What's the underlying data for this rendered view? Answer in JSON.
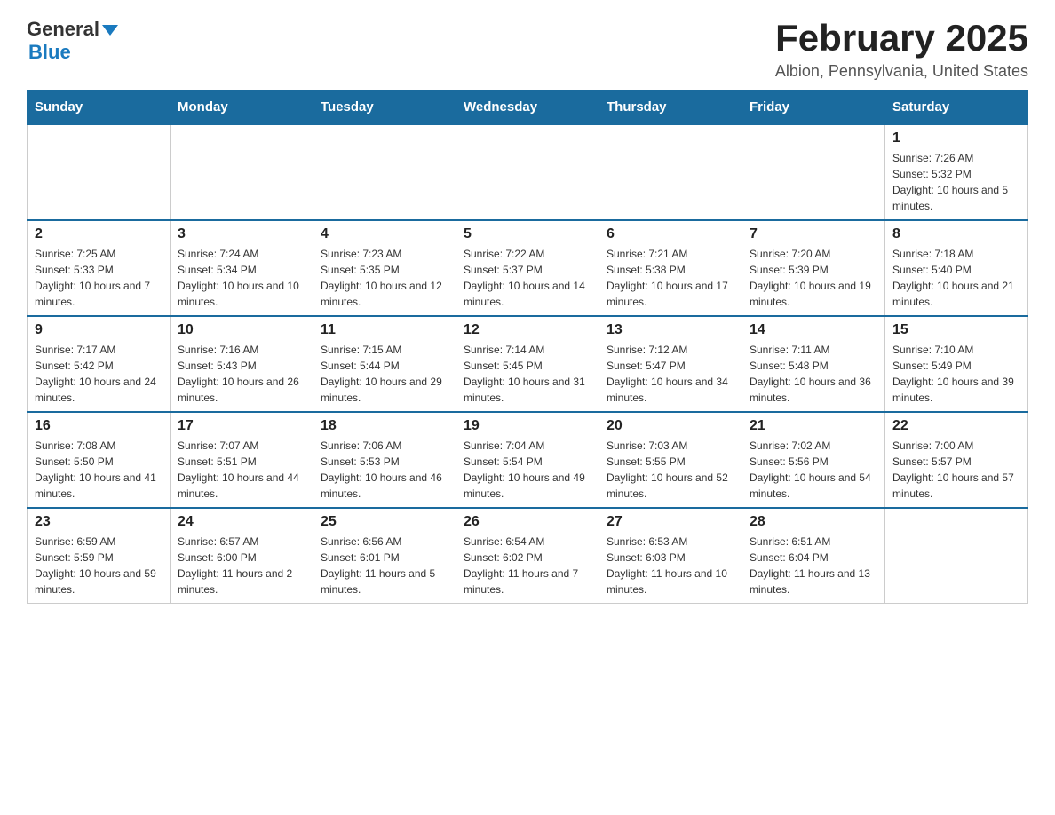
{
  "header": {
    "logo_general": "General",
    "logo_blue": "Blue",
    "month_title": "February 2025",
    "location": "Albion, Pennsylvania, United States"
  },
  "weekdays": [
    "Sunday",
    "Monday",
    "Tuesday",
    "Wednesday",
    "Thursday",
    "Friday",
    "Saturday"
  ],
  "weeks": [
    [
      {
        "day": "",
        "sunrise": "",
        "sunset": "",
        "daylight": ""
      },
      {
        "day": "",
        "sunrise": "",
        "sunset": "",
        "daylight": ""
      },
      {
        "day": "",
        "sunrise": "",
        "sunset": "",
        "daylight": ""
      },
      {
        "day": "",
        "sunrise": "",
        "sunset": "",
        "daylight": ""
      },
      {
        "day": "",
        "sunrise": "",
        "sunset": "",
        "daylight": ""
      },
      {
        "day": "",
        "sunrise": "",
        "sunset": "",
        "daylight": ""
      },
      {
        "day": "1",
        "sunrise": "Sunrise: 7:26 AM",
        "sunset": "Sunset: 5:32 PM",
        "daylight": "Daylight: 10 hours and 5 minutes."
      }
    ],
    [
      {
        "day": "2",
        "sunrise": "Sunrise: 7:25 AM",
        "sunset": "Sunset: 5:33 PM",
        "daylight": "Daylight: 10 hours and 7 minutes."
      },
      {
        "day": "3",
        "sunrise": "Sunrise: 7:24 AM",
        "sunset": "Sunset: 5:34 PM",
        "daylight": "Daylight: 10 hours and 10 minutes."
      },
      {
        "day": "4",
        "sunrise": "Sunrise: 7:23 AM",
        "sunset": "Sunset: 5:35 PM",
        "daylight": "Daylight: 10 hours and 12 minutes."
      },
      {
        "day": "5",
        "sunrise": "Sunrise: 7:22 AM",
        "sunset": "Sunset: 5:37 PM",
        "daylight": "Daylight: 10 hours and 14 minutes."
      },
      {
        "day": "6",
        "sunrise": "Sunrise: 7:21 AM",
        "sunset": "Sunset: 5:38 PM",
        "daylight": "Daylight: 10 hours and 17 minutes."
      },
      {
        "day": "7",
        "sunrise": "Sunrise: 7:20 AM",
        "sunset": "Sunset: 5:39 PM",
        "daylight": "Daylight: 10 hours and 19 minutes."
      },
      {
        "day": "8",
        "sunrise": "Sunrise: 7:18 AM",
        "sunset": "Sunset: 5:40 PM",
        "daylight": "Daylight: 10 hours and 21 minutes."
      }
    ],
    [
      {
        "day": "9",
        "sunrise": "Sunrise: 7:17 AM",
        "sunset": "Sunset: 5:42 PM",
        "daylight": "Daylight: 10 hours and 24 minutes."
      },
      {
        "day": "10",
        "sunrise": "Sunrise: 7:16 AM",
        "sunset": "Sunset: 5:43 PM",
        "daylight": "Daylight: 10 hours and 26 minutes."
      },
      {
        "day": "11",
        "sunrise": "Sunrise: 7:15 AM",
        "sunset": "Sunset: 5:44 PM",
        "daylight": "Daylight: 10 hours and 29 minutes."
      },
      {
        "day": "12",
        "sunrise": "Sunrise: 7:14 AM",
        "sunset": "Sunset: 5:45 PM",
        "daylight": "Daylight: 10 hours and 31 minutes."
      },
      {
        "day": "13",
        "sunrise": "Sunrise: 7:12 AM",
        "sunset": "Sunset: 5:47 PM",
        "daylight": "Daylight: 10 hours and 34 minutes."
      },
      {
        "day": "14",
        "sunrise": "Sunrise: 7:11 AM",
        "sunset": "Sunset: 5:48 PM",
        "daylight": "Daylight: 10 hours and 36 minutes."
      },
      {
        "day": "15",
        "sunrise": "Sunrise: 7:10 AM",
        "sunset": "Sunset: 5:49 PM",
        "daylight": "Daylight: 10 hours and 39 minutes."
      }
    ],
    [
      {
        "day": "16",
        "sunrise": "Sunrise: 7:08 AM",
        "sunset": "Sunset: 5:50 PM",
        "daylight": "Daylight: 10 hours and 41 minutes."
      },
      {
        "day": "17",
        "sunrise": "Sunrise: 7:07 AM",
        "sunset": "Sunset: 5:51 PM",
        "daylight": "Daylight: 10 hours and 44 minutes."
      },
      {
        "day": "18",
        "sunrise": "Sunrise: 7:06 AM",
        "sunset": "Sunset: 5:53 PM",
        "daylight": "Daylight: 10 hours and 46 minutes."
      },
      {
        "day": "19",
        "sunrise": "Sunrise: 7:04 AM",
        "sunset": "Sunset: 5:54 PM",
        "daylight": "Daylight: 10 hours and 49 minutes."
      },
      {
        "day": "20",
        "sunrise": "Sunrise: 7:03 AM",
        "sunset": "Sunset: 5:55 PM",
        "daylight": "Daylight: 10 hours and 52 minutes."
      },
      {
        "day": "21",
        "sunrise": "Sunrise: 7:02 AM",
        "sunset": "Sunset: 5:56 PM",
        "daylight": "Daylight: 10 hours and 54 minutes."
      },
      {
        "day": "22",
        "sunrise": "Sunrise: 7:00 AM",
        "sunset": "Sunset: 5:57 PM",
        "daylight": "Daylight: 10 hours and 57 minutes."
      }
    ],
    [
      {
        "day": "23",
        "sunrise": "Sunrise: 6:59 AM",
        "sunset": "Sunset: 5:59 PM",
        "daylight": "Daylight: 10 hours and 59 minutes."
      },
      {
        "day": "24",
        "sunrise": "Sunrise: 6:57 AM",
        "sunset": "Sunset: 6:00 PM",
        "daylight": "Daylight: 11 hours and 2 minutes."
      },
      {
        "day": "25",
        "sunrise": "Sunrise: 6:56 AM",
        "sunset": "Sunset: 6:01 PM",
        "daylight": "Daylight: 11 hours and 5 minutes."
      },
      {
        "day": "26",
        "sunrise": "Sunrise: 6:54 AM",
        "sunset": "Sunset: 6:02 PM",
        "daylight": "Daylight: 11 hours and 7 minutes."
      },
      {
        "day": "27",
        "sunrise": "Sunrise: 6:53 AM",
        "sunset": "Sunset: 6:03 PM",
        "daylight": "Daylight: 11 hours and 10 minutes."
      },
      {
        "day": "28",
        "sunrise": "Sunrise: 6:51 AM",
        "sunset": "Sunset: 6:04 PM",
        "daylight": "Daylight: 11 hours and 13 minutes."
      },
      {
        "day": "",
        "sunrise": "",
        "sunset": "",
        "daylight": ""
      }
    ]
  ]
}
